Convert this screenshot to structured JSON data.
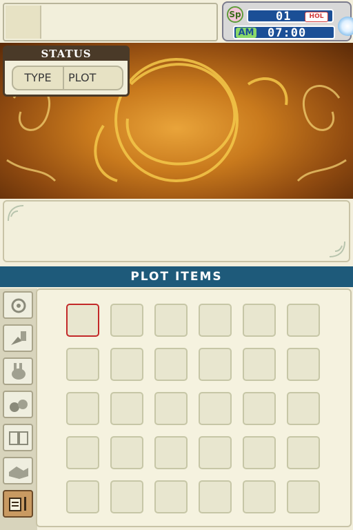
{
  "top": {
    "clock": {
      "season": "Sp",
      "day": "01",
      "holiday_badge": "HOL",
      "ampm": "AM",
      "time": "07:00"
    },
    "status": {
      "title": "STATUS",
      "type_label": "TYPE",
      "type_value": "PLOT"
    }
  },
  "bottom": {
    "title": "PLOT ITEMS",
    "tabs": [
      "settings-tab",
      "tools-tab",
      "animals-tab",
      "crops-tab",
      "book-tab",
      "handshake-tab",
      "plot-tab"
    ],
    "active_tab_index": 6,
    "grid": {
      "rows": 5,
      "cols": 6,
      "selected_index": 0
    }
  },
  "colors": {
    "header": "#1e5a7a",
    "selection": "#c22828",
    "panel": "#f2efdb"
  }
}
